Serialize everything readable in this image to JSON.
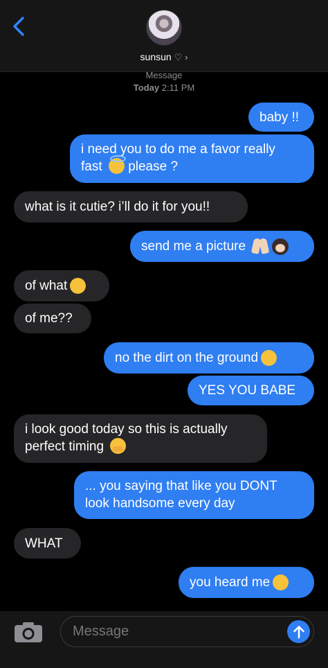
{
  "header": {
    "contact_name": "sunsun",
    "heart": "♡",
    "chevron": "›"
  },
  "thread": {
    "service_label": "Message",
    "date_label": "Today",
    "time_label": "2:11 PM"
  },
  "messages": [
    {
      "from": "me",
      "text": "baby !!"
    },
    {
      "from": "me",
      "line1": "i need you to do me a favor really",
      "line2_start": "fast",
      "line2_end": "please ?",
      "emoji": "smiling-face-with-halo"
    },
    {
      "from": "them",
      "text": "what is it cutie? i’ll do it for you!!"
    },
    {
      "from": "me",
      "text": "send me a picture",
      "emoji": [
        "folded-hands",
        "woman-bowing"
      ]
    },
    {
      "from": "them",
      "text": "of what",
      "emoji": "face-with-raised-eyebrow"
    },
    {
      "from": "them",
      "text": "of me??"
    },
    {
      "from": "me",
      "text": "no the dirt on the ground",
      "emoji": "neutral-face"
    },
    {
      "from": "me",
      "text": "YES YOU BABE"
    },
    {
      "from": "them",
      "line1": "i look good today so this is actually",
      "line2": "perfect timing",
      "emoji": "face-with-open-eyes-and-hand-over-mouth"
    },
    {
      "from": "me",
      "line1": "... you saying that like you DONT",
      "line2": "look handsome every day"
    },
    {
      "from": "them",
      "text": "WHAT"
    },
    {
      "from": "me",
      "text": "you heard me",
      "emoji": "unamused-face"
    }
  ],
  "composer": {
    "placeholder": "Message",
    "camera_icon": "camera-icon",
    "send_icon": "arrow-up-icon"
  },
  "colors": {
    "outgoing_bubble": "#2f7ef2",
    "incoming_bubble": "#262628",
    "accent": "#2f7ef2"
  }
}
